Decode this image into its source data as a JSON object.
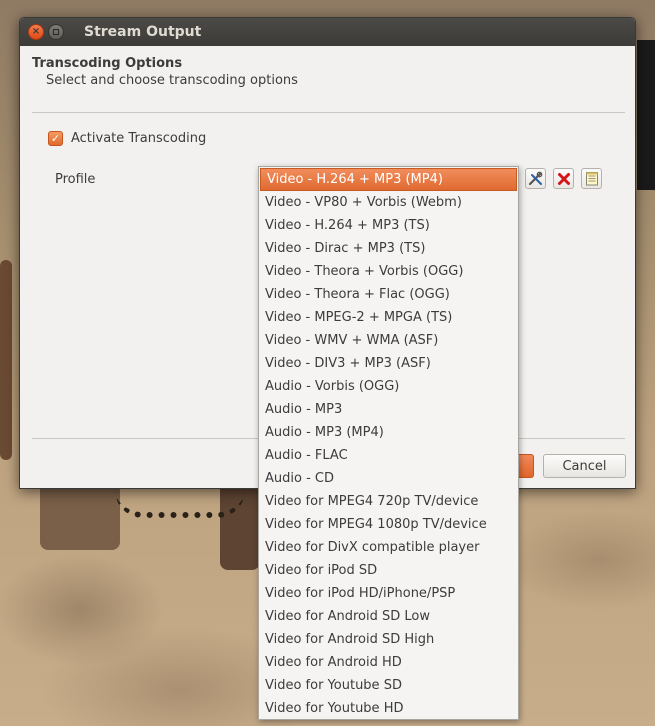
{
  "window": {
    "title": "Stream Output"
  },
  "header": {
    "title": "Transcoding Options",
    "subtitle": "Select and choose transcoding options"
  },
  "transcoding": {
    "checkbox_label": "Activate Transcoding",
    "checked": true,
    "profile_label": "Profile",
    "selected_profile": "Video - H.264 + MP3 (MP4)"
  },
  "profile_options": [
    "Video - H.264 + MP3 (MP4)",
    "Video - VP80 + Vorbis (Webm)",
    "Video - H.264 + MP3 (TS)",
    "Video - Dirac + MP3 (TS)",
    "Video - Theora + Vorbis (OGG)",
    "Video - Theora + Flac (OGG)",
    "Video - MPEG-2 + MPGA (TS)",
    "Video - WMV + WMA (ASF)",
    "Video - DIV3 + MP3 (ASF)",
    "Audio - Vorbis (OGG)",
    "Audio - MP3",
    "Audio - MP3 (MP4)",
    "Audio - FLAC",
    "Audio - CD",
    "Video for MPEG4 720p TV/device",
    "Video for MPEG4 1080p TV/device",
    "Video for DivX compatible player",
    "Video for iPod SD",
    "Video for iPod HD/iPhone/PSP",
    "Video for Android SD Low",
    "Video for Android SD High",
    "Video for Android HD",
    "Video for Youtube SD",
    "Video for Youtube HD"
  ],
  "buttons": {
    "cancel_label": "Cancel"
  },
  "icons": {
    "edit_profile": "wrench-screwdriver-icon",
    "delete_profile": "red-x-icon",
    "new_profile": "notepad-icon"
  },
  "colors": {
    "accent": "#e0652a",
    "titlebar": "#3c3b37",
    "window_bg": "#f2f1f0"
  }
}
